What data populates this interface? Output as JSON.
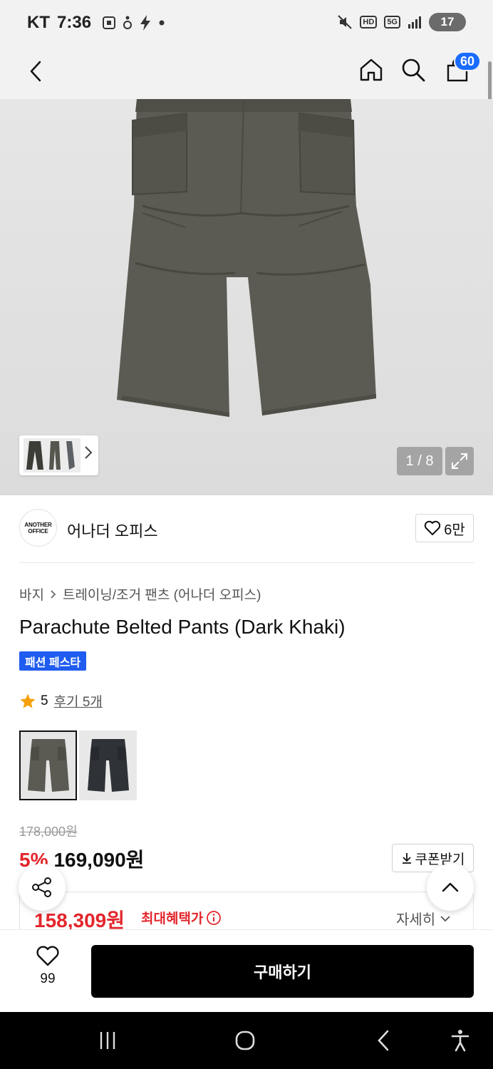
{
  "status_bar": {
    "carrier": "KT",
    "time": "7:36",
    "network_badge": "HD",
    "network_type": "5G",
    "battery": "17",
    "icons": [
      "screenshot-icon",
      "accessibility-icon",
      "lightning-icon",
      "dot-icon",
      "mute-icon",
      "signal-icon",
      "battery-icon"
    ]
  },
  "header": {
    "cart_count": "60",
    "icons": [
      "back-arrow-icon",
      "home-icon",
      "search-icon",
      "shopping-bag-icon"
    ]
  },
  "gallery": {
    "counter": "1 / 8",
    "icons": [
      "chevron-right-icon",
      "expand-icon"
    ]
  },
  "brand": {
    "logo_line1": "ANOTHER",
    "logo_line2": "OFFICE",
    "name": "어나더 오피스",
    "likes": "6만"
  },
  "product": {
    "breadcrumb": [
      "바지",
      "트레이닝/조거 팬츠 (어나더 오피스)"
    ],
    "title": "Parachute Belted Pants (Dark Khaki)",
    "badge": "패션 페스타",
    "rating": "5",
    "reviews": "후기 5개",
    "color_options": [
      "Dark Khaki",
      "Charcoal"
    ]
  },
  "pricing": {
    "original_price": "178,000원",
    "discount_rate": "5%",
    "sale_price": "169,090원",
    "coupon_label": "쿠폰받기",
    "max_benefit_price": "158,309원",
    "max_benefit_label": "최대혜택가",
    "detail_label": "자세히"
  },
  "action_bar": {
    "wish_count": "99",
    "buy_label": "구매하기"
  },
  "colors": {
    "accent_blue": "#1a6cff",
    "badge_blue": "#1f5cf0",
    "sale_red": "#e3262c",
    "pants_khaki": "#5b5b53",
    "pants_charcoal": "#2f3338"
  }
}
